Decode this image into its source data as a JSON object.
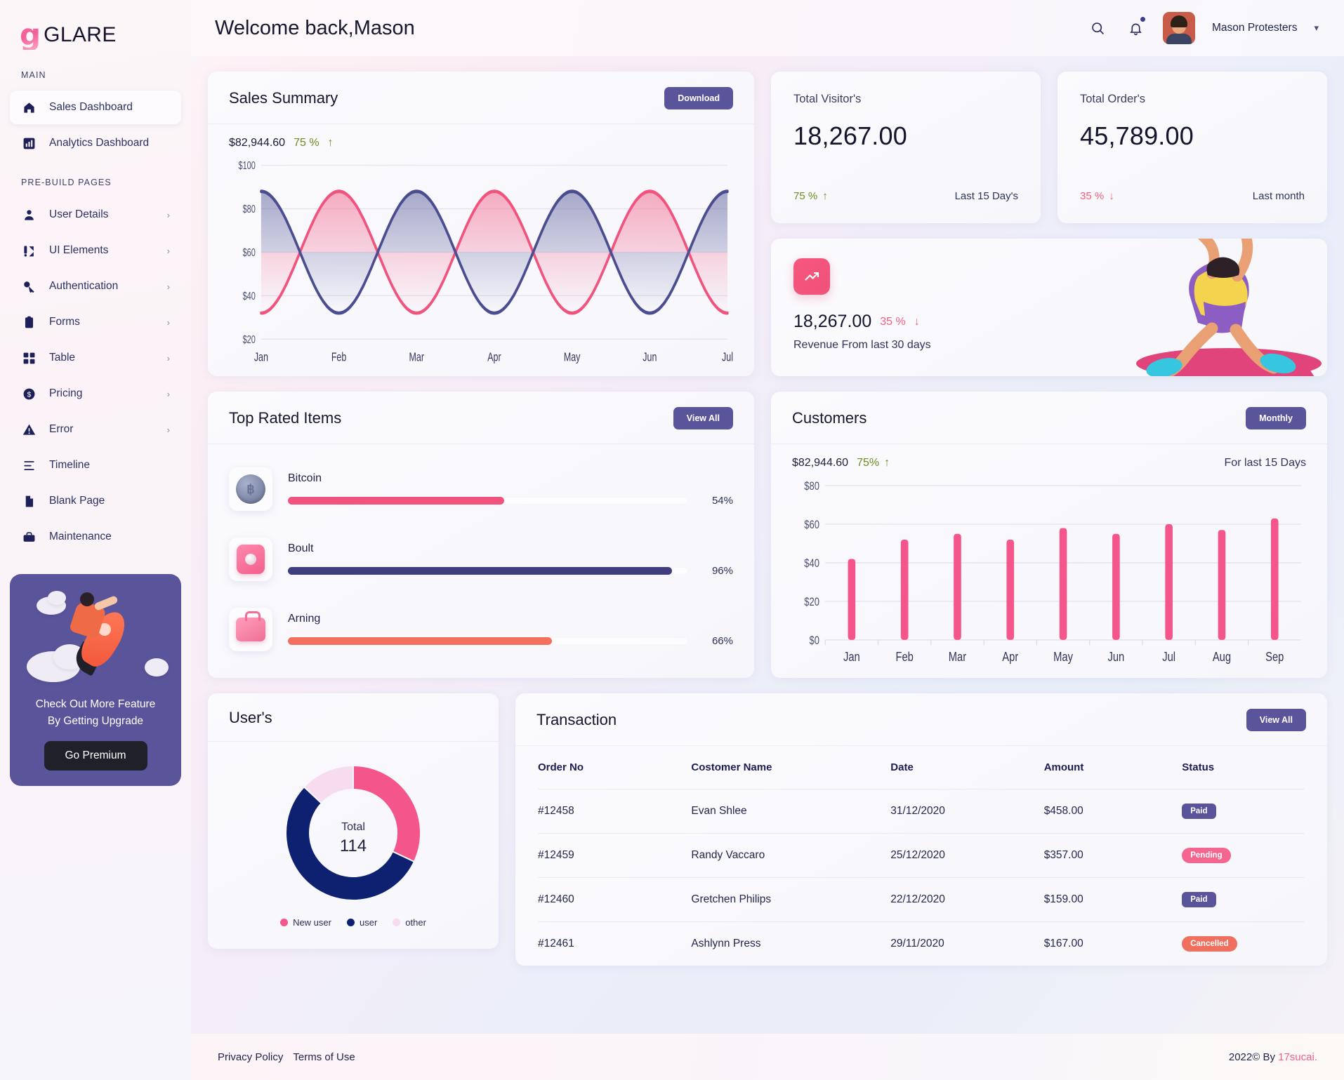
{
  "brand": {
    "mark": "g",
    "name": "GLARE"
  },
  "header": {
    "welcome": "Welcome back,Mason",
    "search_icon": "search-icon",
    "bell_icon": "bell-icon",
    "user_name": "Mason Protesters",
    "caret": "▾"
  },
  "sidebar": {
    "section_main": "MAIN",
    "section_prebuild": "PRE-BUILD PAGES",
    "main_items": [
      {
        "label": "Sales Dashboard",
        "icon": "home-icon",
        "active": true
      },
      {
        "label": "Analytics Dashboard",
        "icon": "bar-chart-icon",
        "active": false
      }
    ],
    "prebuild_items": [
      {
        "label": "User Details",
        "icon": "user-icon",
        "chevron": "›"
      },
      {
        "label": "UI Elements",
        "icon": "ui-elements-icon",
        "chevron": "›"
      },
      {
        "label": "Authentication",
        "icon": "key-icon",
        "chevron": "›"
      },
      {
        "label": "Forms",
        "icon": "clipboard-icon",
        "chevron": "›"
      },
      {
        "label": "Table",
        "icon": "grid-icon",
        "chevron": "›"
      },
      {
        "label": "Pricing",
        "icon": "dollar-icon",
        "chevron": "›"
      },
      {
        "label": "Error",
        "icon": "warning-icon",
        "chevron": "›"
      },
      {
        "label": "Timeline",
        "icon": "timeline-icon",
        "chevron": ""
      },
      {
        "label": "Blank Page",
        "icon": "document-icon",
        "chevron": ""
      },
      {
        "label": "Maintenance",
        "icon": "toolbox-icon",
        "chevron": ""
      }
    ],
    "promo": {
      "line1": "Check Out More Feature",
      "line2": "By Getting Upgrade",
      "button": "Go Premium"
    }
  },
  "sales_summary": {
    "title": "Sales Summary",
    "download_label": "Download",
    "amount": "$82,944.60",
    "percent": "75 %",
    "trend_icon": "arrow-up-icon"
  },
  "stats": [
    {
      "label": "Total Visitor's",
      "value": "18,267.00",
      "percent": "75 %",
      "dir": "up",
      "arrow": "↑",
      "period": "Last 15 Day's"
    },
    {
      "label": "Total Order's",
      "value": "45,789.00",
      "percent": "35 %",
      "dir": "down",
      "arrow": "↓",
      "period": "Last month"
    }
  ],
  "revenue": {
    "icon": "trending-up-icon",
    "value": "18,267.00",
    "percent": "35 %",
    "arrow": "↓",
    "caption": "Revenue From last 30 days"
  },
  "top_rated": {
    "title": "Top Rated Items",
    "view_all": "View All",
    "items": [
      {
        "name": "Bitcoin",
        "pct": "54%",
        "value": 54,
        "color": "#f0547e",
        "icon": "coin-icon"
      },
      {
        "name": "Boult",
        "pct": "96%",
        "value": 96,
        "color": "#3f3d7e",
        "icon": "speaker-icon"
      },
      {
        "name": "Arning",
        "pct": "66%",
        "value": 66,
        "color": "#f4705c",
        "icon": "bag-icon"
      }
    ]
  },
  "customers": {
    "title": "Customers",
    "monthly_label": "Monthly",
    "amount": "$82,944.60",
    "percent": "75%",
    "arrow": "↑",
    "period": "For last 15 Days"
  },
  "users_card": {
    "title": "User's",
    "center_label": "Total",
    "center_value": "114"
  },
  "transaction": {
    "title": "Transaction",
    "view_all": "View All",
    "columns": [
      "Order No",
      "Costomer Name",
      "Date",
      "Amount",
      "Status"
    ],
    "rows": [
      {
        "order": "#12458",
        "customer": "Evan Shlee",
        "date": "31/12/2020",
        "amount": "$458.00",
        "status": "Paid",
        "status_kind": "paid"
      },
      {
        "order": "#12459",
        "customer": "Randy Vaccaro",
        "date": "25/12/2020",
        "amount": "$357.00",
        "status": "Pending",
        "status_kind": "pending"
      },
      {
        "order": "#12460",
        "customer": "Gretchen Philips",
        "date": "22/12/2020",
        "amount": "$159.00",
        "status": "Paid",
        "status_kind": "paid"
      },
      {
        "order": "#12461",
        "customer": "Ashlynn Press",
        "date": "29/11/2020",
        "amount": "$167.00",
        "status": "Cancelled",
        "status_kind": "cancelled"
      }
    ]
  },
  "footer": {
    "privacy": "Privacy Policy",
    "terms": "Terms of Use",
    "copyright": "2022© By ",
    "credit": "17sucai."
  },
  "chart_data": [
    {
      "type": "line",
      "name": "sales-summary-chart",
      "title": "Sales Summary",
      "x": [
        "Jan",
        "Feb",
        "Mar",
        "Apr",
        "May",
        "Jun",
        "Jul"
      ],
      "ytick_labels": [
        "$100",
        "$80",
        "$60",
        "$40",
        "$20"
      ],
      "ylim": [
        20,
        100
      ],
      "grid": true,
      "legend": "none",
      "series": [
        {
          "name": "series-pink",
          "color": "#f0547e",
          "phase": 180,
          "amplitude": 28,
          "mean": 60,
          "values": [
            32,
            88,
            32,
            88,
            32,
            88,
            32
          ]
        },
        {
          "name": "series-navy",
          "color": "#4a4d8f",
          "phase": 0,
          "amplitude": 28,
          "mean": 60,
          "values": [
            88,
            32,
            88,
            32,
            88,
            32,
            88
          ]
        }
      ]
    },
    {
      "type": "bar",
      "name": "customers-chart",
      "title": "Customers",
      "categories": [
        "Jan",
        "Feb",
        "Mar",
        "Apr",
        "May",
        "Jun",
        "Jul",
        "Aug",
        "Sep"
      ],
      "values": [
        42,
        52,
        55,
        52,
        58,
        55,
        60,
        57,
        63
      ],
      "ytick_labels": [
        "$80",
        "$60",
        "$40",
        "$20",
        "$0"
      ],
      "ylim": [
        0,
        80
      ],
      "color": "#f4558a",
      "grid": true
    },
    {
      "type": "pie",
      "name": "users-donut",
      "title": "User's",
      "labels": [
        "New user",
        "user",
        "other"
      ],
      "values": [
        32,
        55,
        13
      ],
      "colors": [
        "#f4558a",
        "#0d2170",
        "#f6dcee"
      ],
      "center_label": "Total",
      "center_value": "114",
      "legend": "bottom"
    }
  ]
}
